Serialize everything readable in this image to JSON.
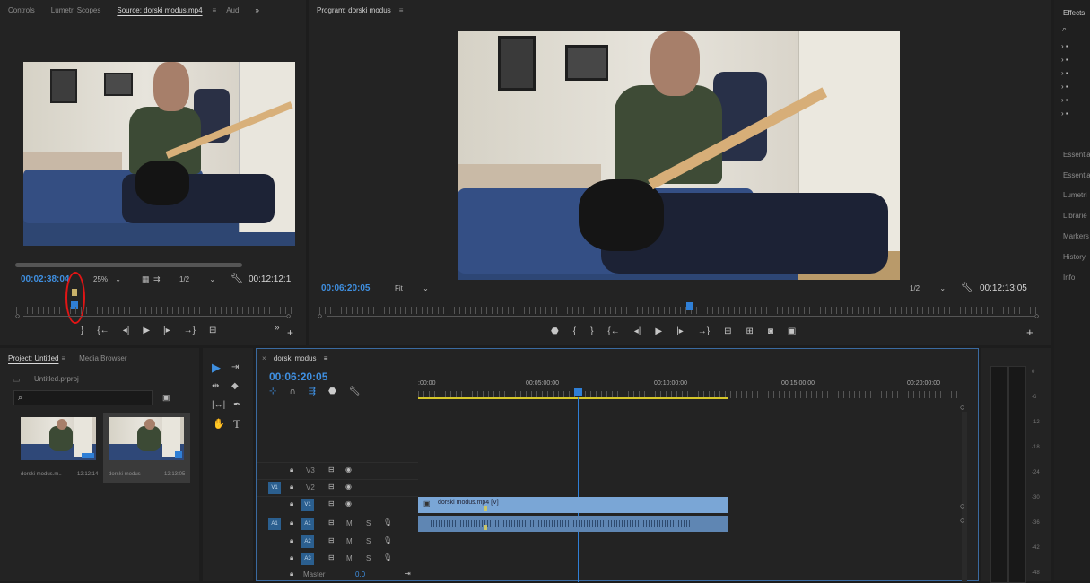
{
  "source_panel": {
    "tabs": [
      "Controls",
      "Lumetri Scopes",
      "Source: dorski modus.mp4",
      "≡",
      "Aud",
      "»"
    ],
    "timecode": "00:02:38:04",
    "zoom": "25%",
    "resolution": "1/2",
    "duration": "00:12:12:1",
    "controls_more": "»",
    "add": "+"
  },
  "program_panel": {
    "tab_title": "Program: dorski modus",
    "menu": "≡",
    "timecode": "00:06:20:05",
    "fit": "Fit",
    "resolution": "1/2",
    "duration": "00:12:13:05",
    "add": "+"
  },
  "right_sidebar": {
    "effects_title": "Effects",
    "items": [
      "Essentia",
      "Essentia",
      "Lumetri",
      "Librarie",
      "Markers",
      "History",
      "Info"
    ]
  },
  "project_panel": {
    "tabs": [
      "Project: Untitled",
      "≡",
      "Media Browser"
    ],
    "file": "Untitled.prproj",
    "clips": [
      {
        "name": "dorski modus.m..",
        "duration": "12:12:14"
      },
      {
        "name": "dorski modus",
        "duration": "12:13:05"
      }
    ]
  },
  "timeline": {
    "tab": "dorski modus",
    "menu": "≡",
    "close": "×",
    "timecode": "00:06:20:05",
    "ruler_labels": [
      ":00:00",
      "00:05:00:00",
      "00:10:00:00",
      "00:15:00:00",
      "00:20:00:00"
    ],
    "tracks": [
      {
        "name": "V3",
        "target": ""
      },
      {
        "name": "V2",
        "target": "V1"
      },
      {
        "name": "V1",
        "target": ""
      },
      {
        "name": "A1",
        "target": "A1"
      },
      {
        "name": "A2",
        "target": ""
      },
      {
        "name": "A3",
        "target": ""
      }
    ],
    "master_label": "Master",
    "master_value": "0.0",
    "video_clip": "dorski modus.mp4 [V]",
    "audio_meter_labels": [
      "0",
      "-6",
      "-12",
      "-18",
      "-24",
      "-30",
      "-36",
      "-42",
      "-48"
    ],
    "mute": "M",
    "solo": "S"
  },
  "colors": {
    "timecode_blue": "#3f8fe0",
    "clip_blue": "#7aa6d6",
    "audio_clip": "#5f86b3",
    "annotation_red": "#e01515"
  }
}
